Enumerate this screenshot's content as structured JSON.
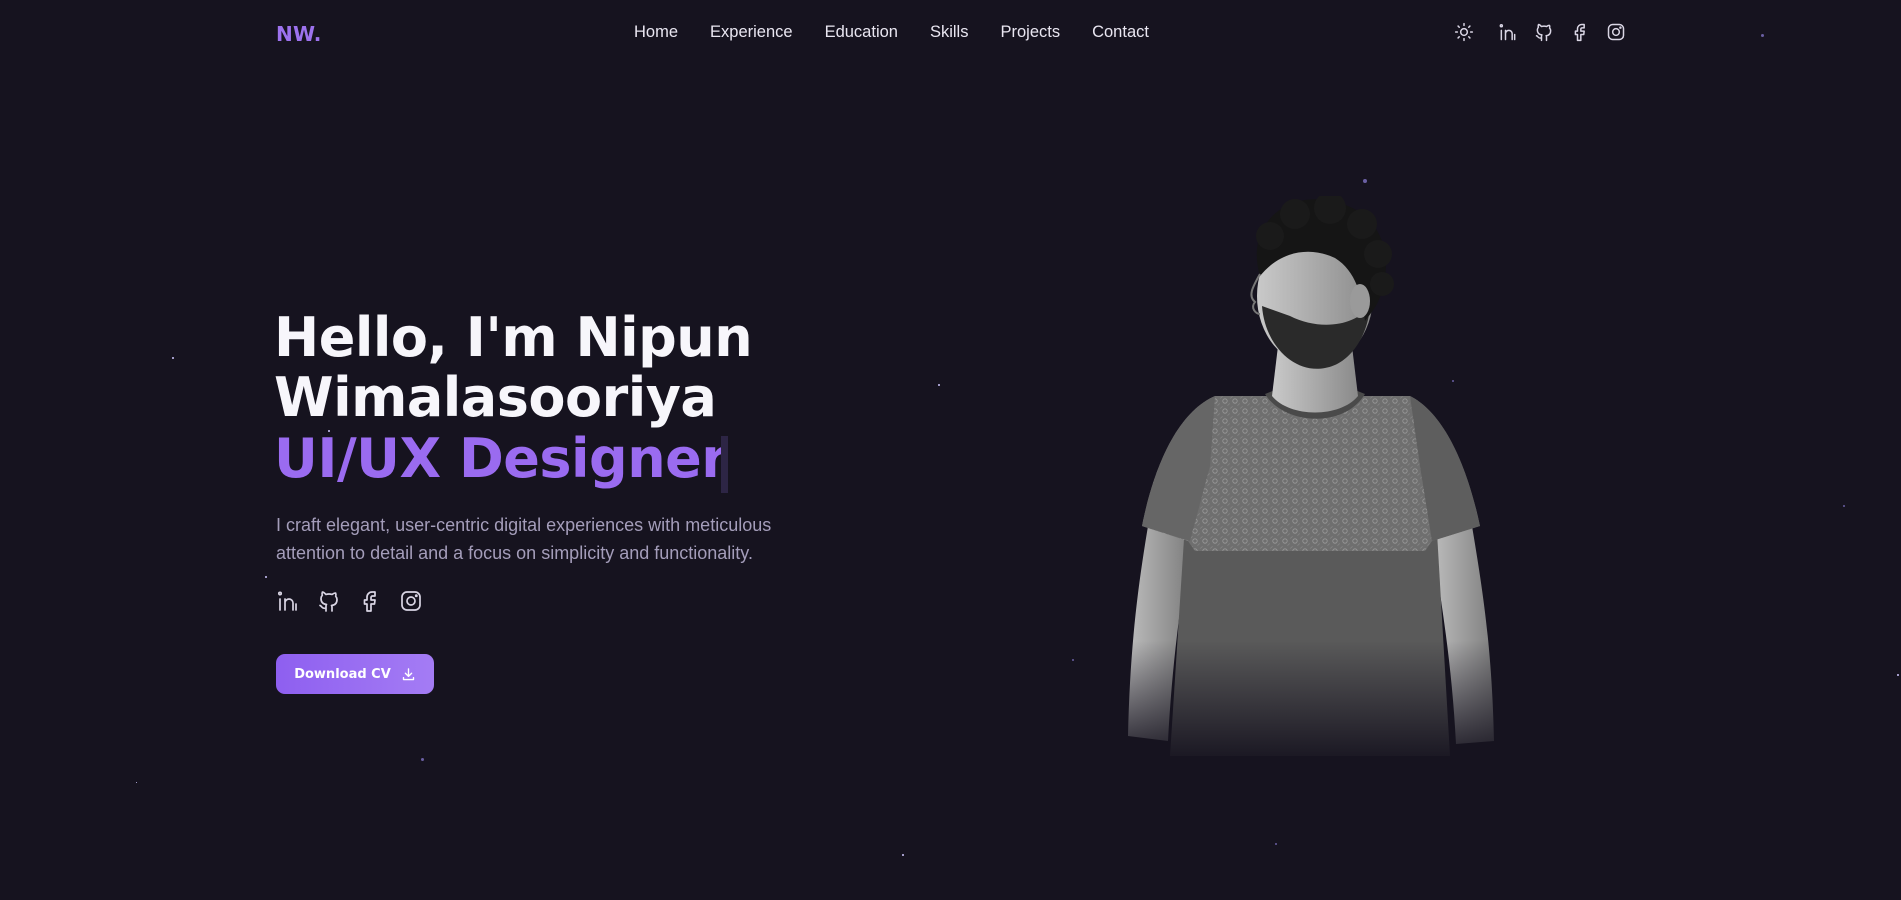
{
  "brand": {
    "logo_text": "NW."
  },
  "nav": {
    "links": [
      "Home",
      "Experience",
      "Education",
      "Skills",
      "Projects",
      "Contact"
    ]
  },
  "nav_icons": [
    "sun-icon",
    "linkedin-icon",
    "github-icon",
    "facebook-icon",
    "instagram-icon"
  ],
  "hero": {
    "title_line1": "Hello, I'm Nipun",
    "title_line2": "Wimalasooriya",
    "role": "UI/UX Designer",
    "description": "I craft elegant, user-centric digital experiences with meticulous attention to detail and a focus on simplicity and functionality.",
    "social_icons": [
      "linkedin-icon",
      "github-icon",
      "facebook-icon",
      "instagram-icon"
    ],
    "download_label": "Download CV"
  },
  "colors": {
    "background": "#16131f",
    "accent": "#9a6bf0",
    "text": "#f4f3f7",
    "muted": "#a49dba"
  }
}
